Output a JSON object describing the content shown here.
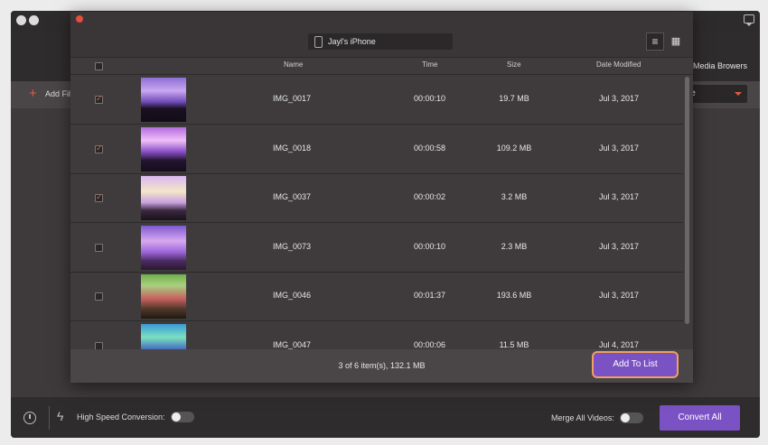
{
  "app": {
    "media_browsers": "Media Browers",
    "add_files_label": "Add Fil",
    "format_value": "vie"
  },
  "dialog": {
    "device_name": "Jayl's iPhone",
    "columns": {
      "name": "Name",
      "time": "Time",
      "size": "Size",
      "date_modified": "Date Modified"
    },
    "rows": [
      {
        "checked": true,
        "name": "IMG_0017",
        "time": "00:00:10",
        "size": "19.7 MB",
        "date": "Jul 3, 2017",
        "thumb": "concert-stage-purple"
      },
      {
        "checked": true,
        "name": "IMG_0018",
        "time": "00:00:58",
        "size": "109.2 MB",
        "date": "Jul 3, 2017",
        "thumb": "concert-stage-pink"
      },
      {
        "checked": true,
        "name": "IMG_0037",
        "time": "00:00:02",
        "size": "3.2 MB",
        "date": "Jul 3, 2017",
        "thumb": "stage-bright"
      },
      {
        "checked": false,
        "name": "IMG_0073",
        "time": "00:00:10",
        "size": "2.3 MB",
        "date": "Jul 3, 2017",
        "thumb": "stage-purple"
      },
      {
        "checked": false,
        "name": "IMG_0046",
        "time": "00:01:37",
        "size": "193.6 MB",
        "date": "Jul 3, 2017",
        "thumb": "stage-green"
      },
      {
        "checked": false,
        "name": "IMG_0047",
        "time": "00:00:06",
        "size": "11.5 MB",
        "date": "Jul 4, 2017",
        "thumb": "stage-blue"
      }
    ],
    "summary": "3 of 6 item(s), 132.1 MB",
    "add_to_list": "Add To List"
  },
  "bottom": {
    "high_speed_label": "High Speed Conversion:",
    "merge_label": "Merge All Videos:",
    "convert_all": "Convert All"
  },
  "colors": {
    "accent": "#7b52c4",
    "highlight": "#f0a060",
    "checkmark": "#e15b3d"
  }
}
